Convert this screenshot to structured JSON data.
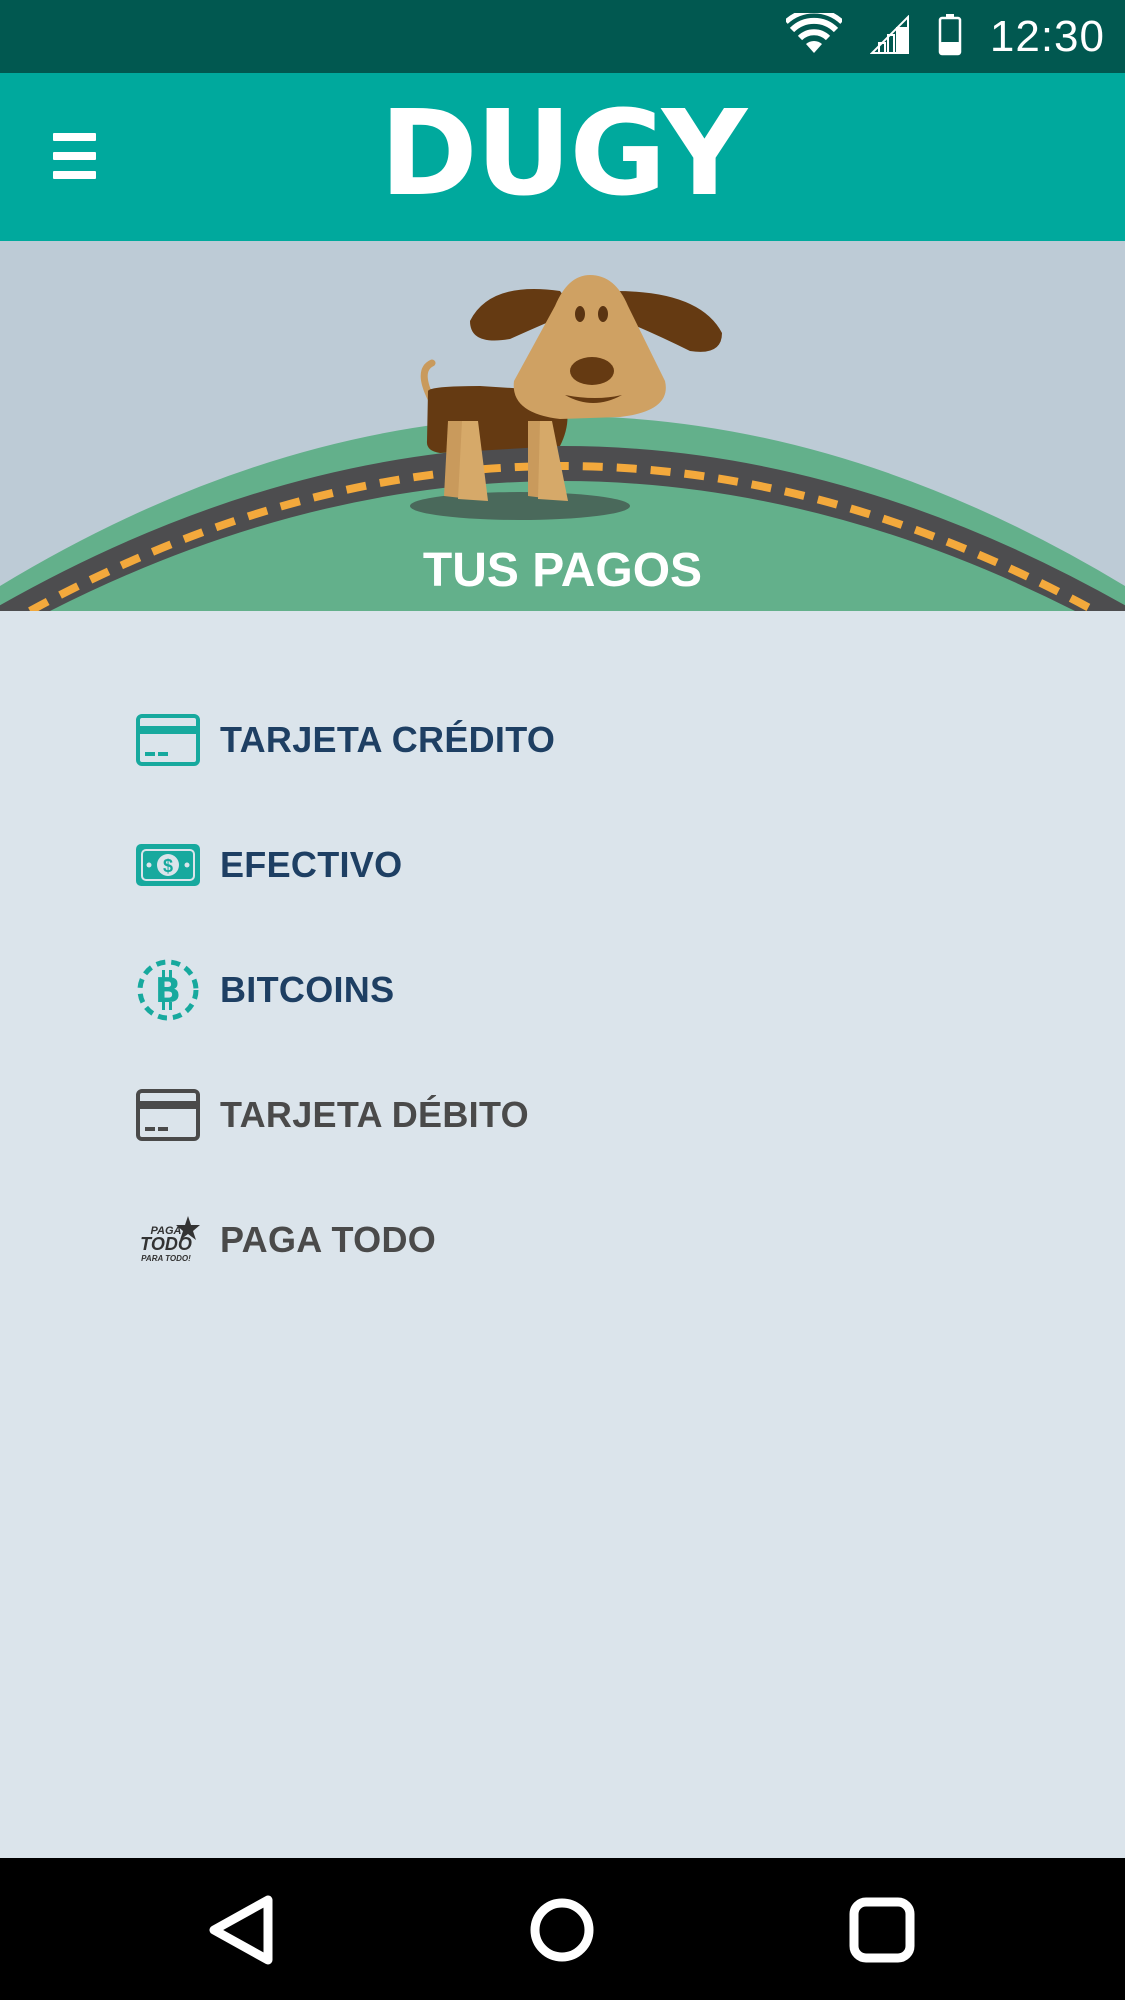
{
  "status_bar": {
    "time": "12:30",
    "icons": [
      "wifi-icon",
      "cellular-signal-icon",
      "battery-icon"
    ]
  },
  "app_bar": {
    "logo": "DUGY",
    "menu_icon": "hamburger-menu-icon"
  },
  "hero": {
    "title": "TUS PAGOS"
  },
  "payment_methods": [
    {
      "label": "TARJETA CRÉDITO",
      "icon": "credit-card-icon",
      "color": "#1e3f63"
    },
    {
      "label": "EFECTIVO",
      "icon": "cash-icon",
      "color": "#1e3f63"
    },
    {
      "label": "BITCOINS",
      "icon": "bitcoin-icon",
      "color": "#1e3f63"
    },
    {
      "label": "TARJETA DÉBITO",
      "icon": "debit-card-icon",
      "color": "#4a4a4a"
    },
    {
      "label": "PAGA TODO",
      "icon": "paga-todo-logo-icon",
      "color": "#4a4a4a",
      "icon_text": [
        "PAGA",
        "TODO",
        "PARA TODO!"
      ]
    }
  ],
  "nav_bar": {
    "buttons": [
      "back-icon",
      "home-icon",
      "recents-icon"
    ]
  },
  "colors": {
    "status_bar": "#015850",
    "app_bar": "#00a99d",
    "accent_teal": "#17a99e",
    "hero_sky": "#bdcbd6",
    "hill_green": "#63b08b",
    "road": "#4d4d4f",
    "road_dash": "#f3a93c",
    "content_bg": "#dbe4eb"
  }
}
